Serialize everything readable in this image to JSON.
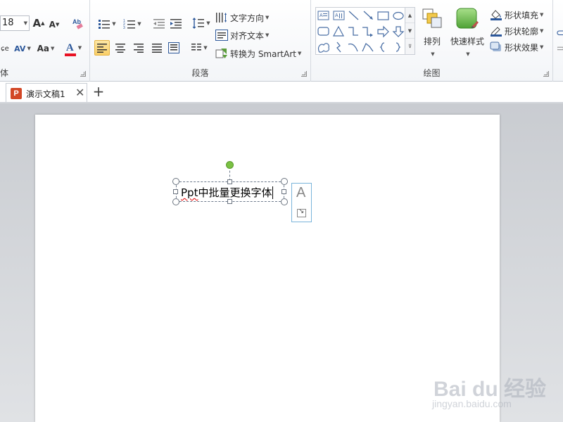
{
  "ribbon": {
    "font_group": {
      "label": "体",
      "font_size": "18",
      "grow_font": "A",
      "shrink_font": "A",
      "spacing_label": "AV",
      "case_label": "Aa",
      "font_color_label": "A",
      "font_color": "#e81123"
    },
    "paragraph_group": {
      "label": "段落",
      "text_direction": "文字方向",
      "align_text": "对齐文本",
      "convert_smartart": "转换为 SmartArt"
    },
    "drawing_group": {
      "label": "绘图",
      "arrange": "排列",
      "quick_styles": "快速样式",
      "shape_fill": "形状填充",
      "shape_outline": "形状轮廓",
      "shape_effects": "形状效果"
    }
  },
  "tabs": {
    "doc_title": "演示文稿1",
    "ppt_badge": "P",
    "close": "✕",
    "add": "+"
  },
  "slide": {
    "text_before": "Ppt",
    "text_after": "中批量更换字体",
    "autofit_letter": "A"
  },
  "watermark": {
    "line1": "Bai du 经验",
    "line2": "jingyan.baidu.com"
  }
}
